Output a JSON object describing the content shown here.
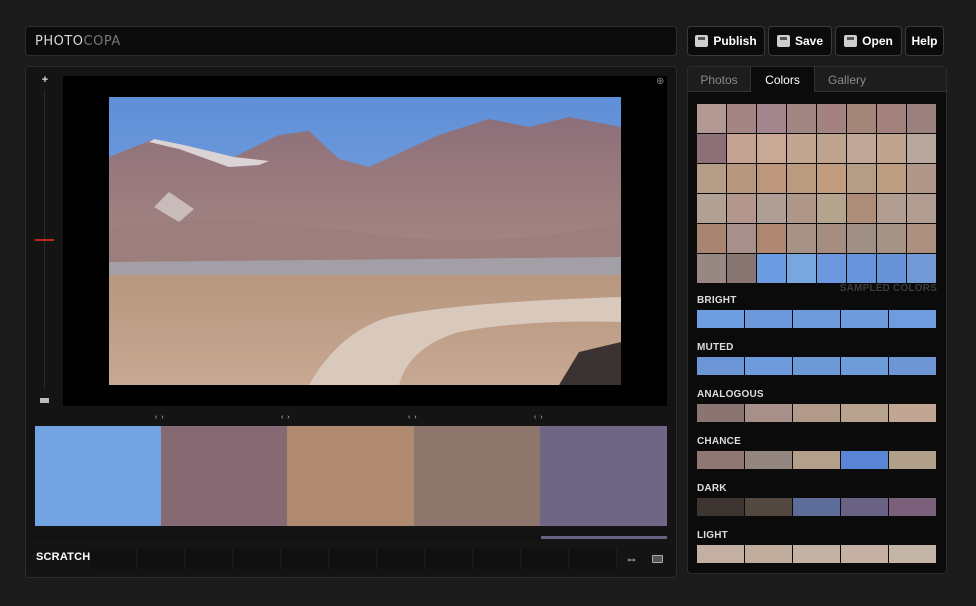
{
  "app": {
    "logo_part1": "PHOTO",
    "logo_part2": "COPA"
  },
  "toolbar": [
    {
      "label": "Publish",
      "icon": "publish-icon"
    },
    {
      "label": "Save",
      "icon": "save-disk-icon"
    },
    {
      "label": "Open",
      "icon": "open-folder-icon"
    },
    {
      "label": "Help"
    }
  ],
  "tabs": [
    {
      "label": "Photos",
      "active": false
    },
    {
      "label": "Colors",
      "active": true
    },
    {
      "label": "Gallery",
      "active": false
    }
  ],
  "palette": [
    "#73a3e0",
    "#856973",
    "#b08a70",
    "#8d766c",
    "#6f6584"
  ],
  "scratch": {
    "label": "SCRATCH"
  },
  "sampled": {
    "label": "SAMPLED COLORS",
    "rows": [
      [
        "#b19893",
        "#a38583",
        "#a3868d",
        "#a28683",
        "#a38282",
        "#a4857a",
        "#a3817d",
        "#9a817e"
      ],
      [
        "#8b7078",
        "#c4a393",
        "#c9a995",
        "#c3a68f",
        "#bea38f",
        "#c1a797",
        "#c1a48f",
        "#b7a79c"
      ],
      [
        "#b69d88",
        "#b89781",
        "#bc977d",
        "#bb9b80",
        "#c29c7e",
        "#b59c87",
        "#bd9e81",
        "#b0978a"
      ],
      [
        "#b1a194",
        "#b3978d",
        "#ae9e95",
        "#ae9789",
        "#b4a48e",
        "#ae8d78",
        "#b09c90",
        "#b19c91"
      ],
      [
        "#a98470",
        "#a7908b",
        "#ae8872",
        "#a69287",
        "#a48c7f",
        "#a08f85",
        "#a59386",
        "#ab907f"
      ],
      [
        "#978883",
        "#887471",
        "#6c9ae0",
        "#78a6de",
        "#6c97de",
        "#6894dc",
        "#6893d6",
        "#7099d6"
      ]
    ]
  },
  "schemes": [
    {
      "name": "BRIGHT",
      "colors": [
        "#6e9de2",
        "#6c97da",
        "#6d9bd9",
        "#6e9bdc",
        "#6f9cdf"
      ]
    },
    {
      "name": "MUTED",
      "colors": [
        "#6c95d6",
        "#6e9bdb",
        "#6c98d6",
        "#6d9cd8",
        "#6e96d5"
      ]
    },
    {
      "name": "ANALOGOUS",
      "colors": [
        "#8a7572",
        "#a78f8a",
        "#b29a8b",
        "#b8a48e",
        "#c0a693"
      ]
    },
    {
      "name": "CHANCE",
      "colors": [
        "#8f7773",
        "#938580",
        "#b49f8a",
        "#5a85d4",
        "#b19f89"
      ]
    },
    {
      "name": "DARK",
      "colors": [
        "#3c3532",
        "#524840",
        "#5d6c98",
        "#6a6285",
        "#7a607a"
      ]
    },
    {
      "name": "LIGHT",
      "colors": [
        "#c4b0a3",
        "#c0ac9d",
        "#c4b2a4",
        "#c4b1a4",
        "#c3b5a8"
      ]
    }
  ]
}
